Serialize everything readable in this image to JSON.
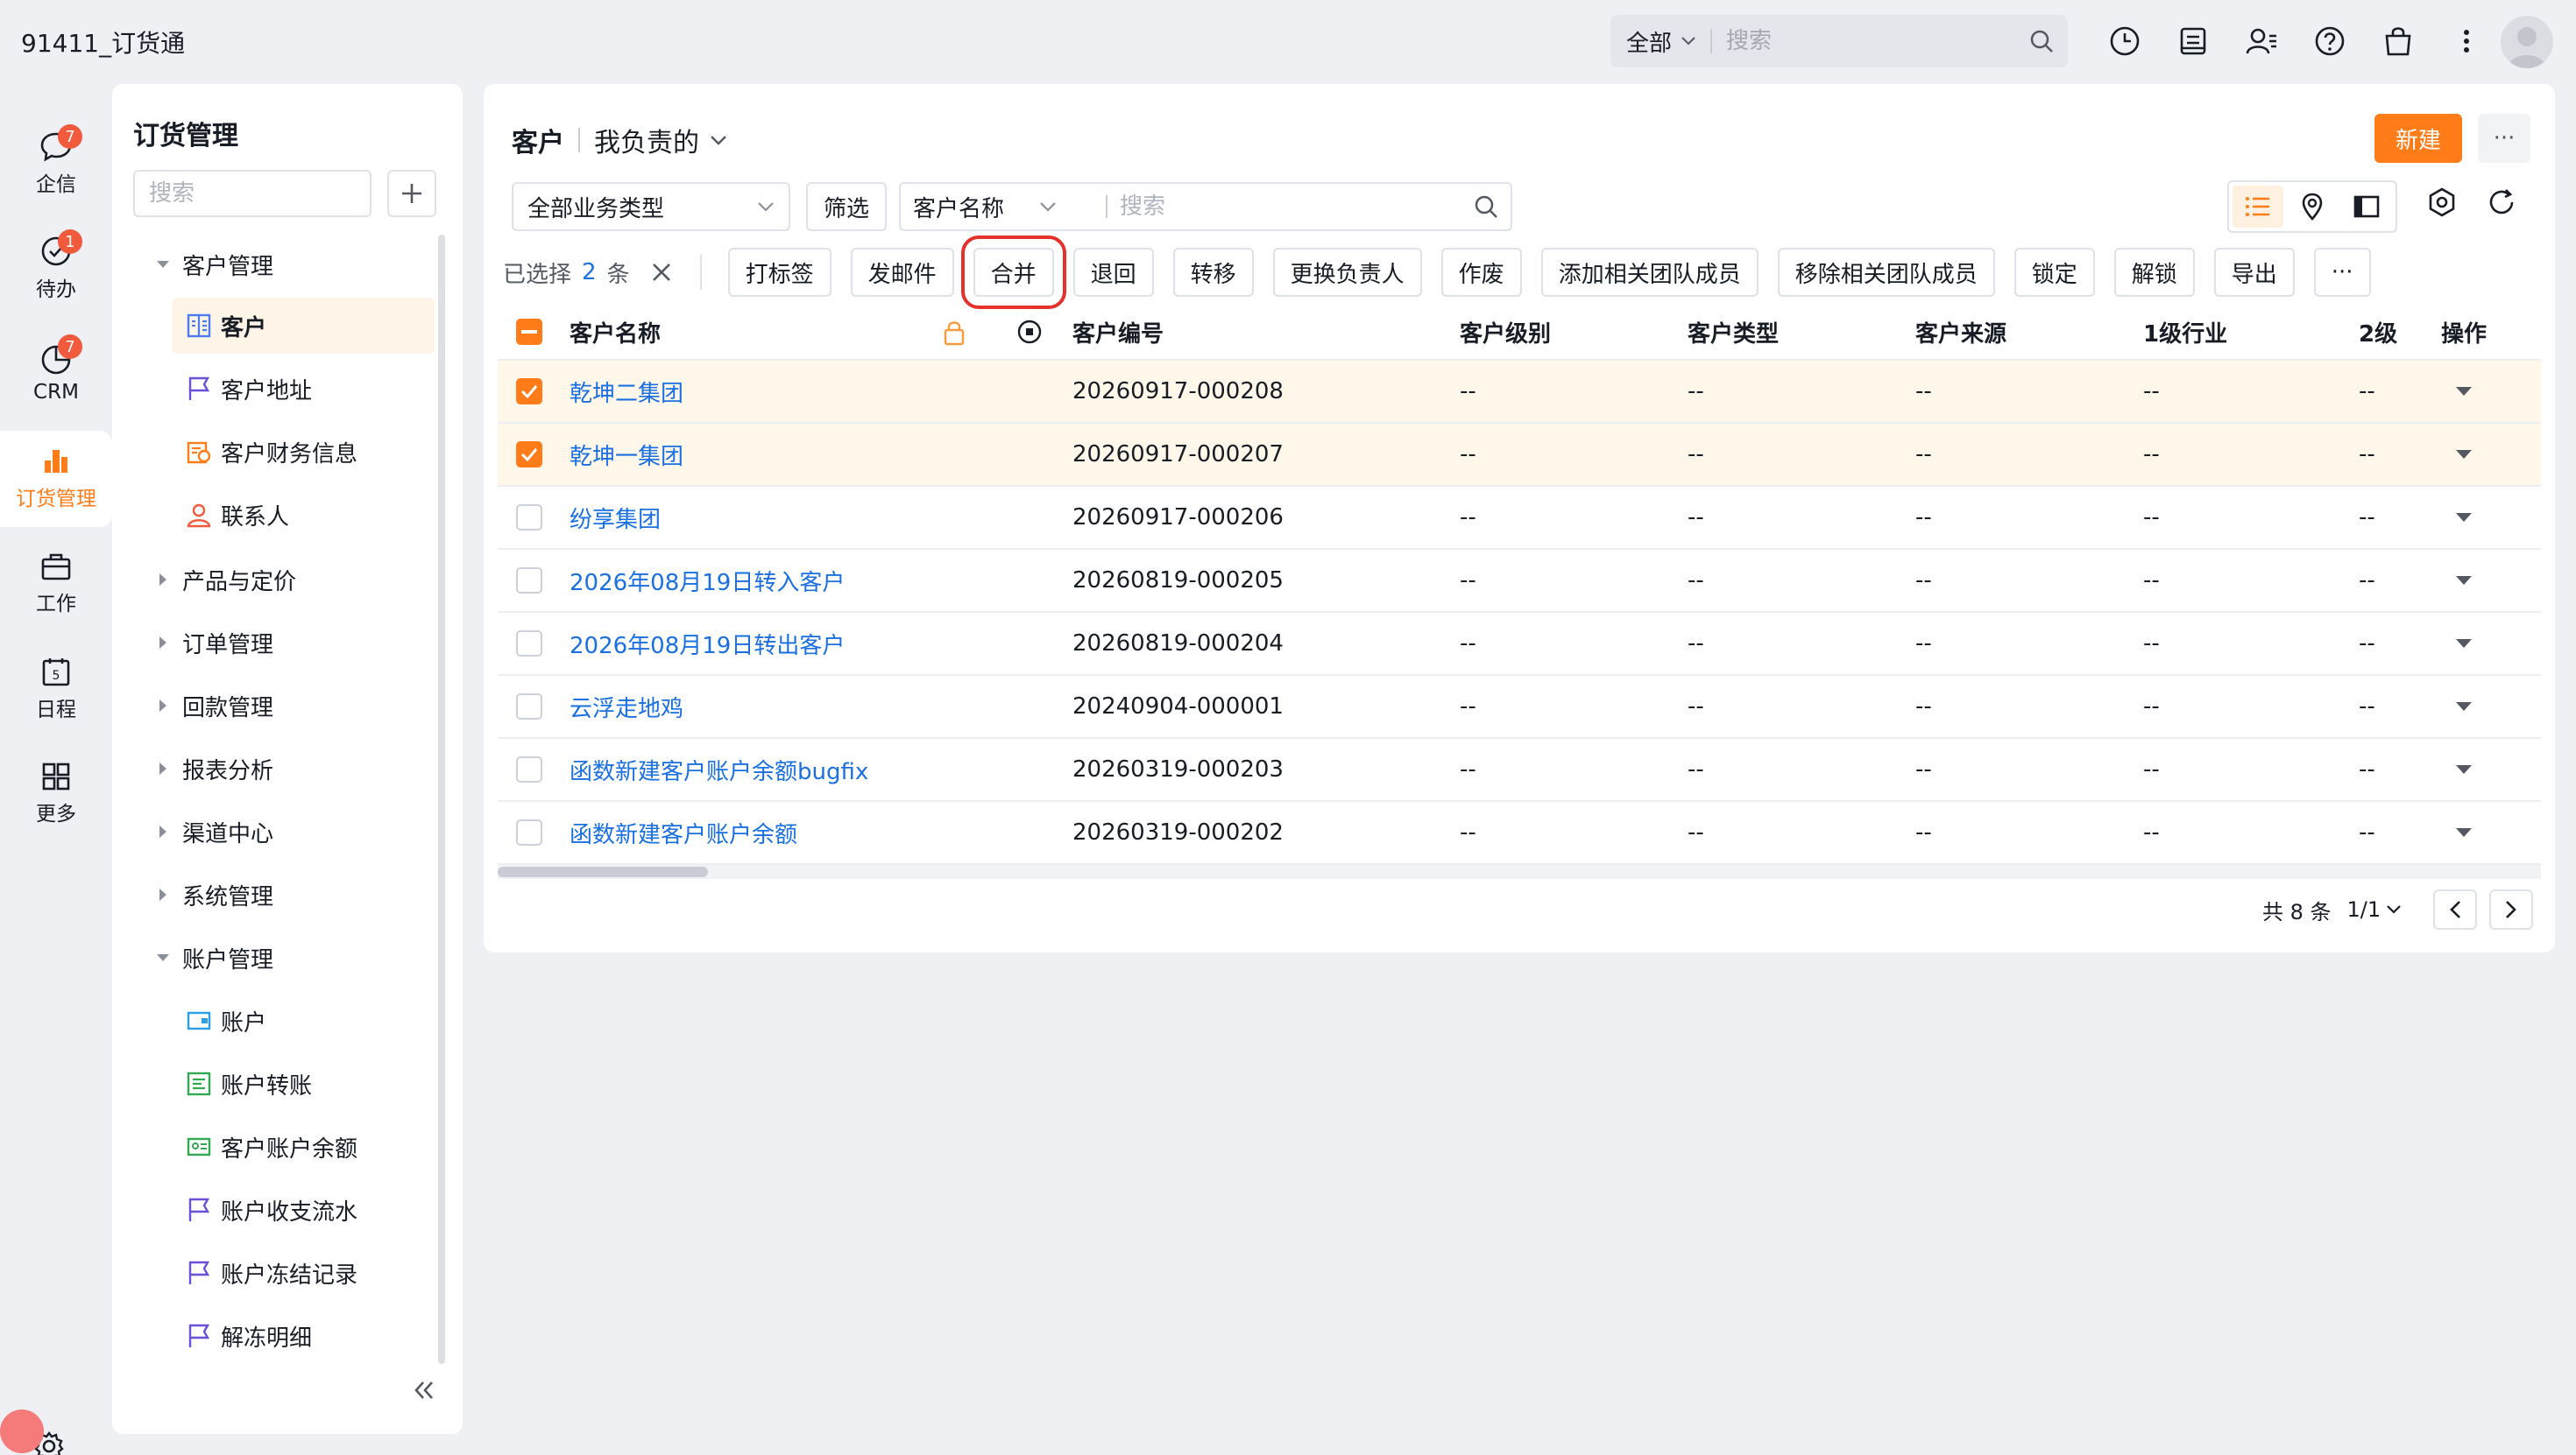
{
  "app": {
    "title": "91411_订货通"
  },
  "header": {
    "search_scope": "全部",
    "search_placeholder": "搜索",
    "icons": [
      "clock-icon",
      "report-icon",
      "contacts-icon",
      "help-icon",
      "store-icon",
      "more-vertical-icon"
    ]
  },
  "rail": {
    "items": [
      {
        "label": "企信",
        "badge": "7",
        "icon": "chat-icon"
      },
      {
        "label": "待办",
        "badge": "1",
        "icon": "todo-check-icon"
      },
      {
        "label": "CRM",
        "badge": "7",
        "icon": "crm-pie-icon"
      },
      {
        "label": "订货管理",
        "badge": "",
        "icon": "order-bars-icon"
      },
      {
        "label": "工作",
        "badge": "",
        "icon": "briefcase-icon"
      },
      {
        "label": "日程",
        "badge": "",
        "icon": "calendar-icon"
      },
      {
        "label": "更多",
        "badge": "",
        "icon": "grid-icon"
      }
    ]
  },
  "sidebar": {
    "title": "订货管理",
    "search_placeholder": "搜索",
    "tree": [
      {
        "label": "客户管理",
        "type": "group",
        "expanded": true
      },
      {
        "label": "客户",
        "type": "child",
        "icon": "customer-doc-icon",
        "active": true
      },
      {
        "label": "客户地址",
        "type": "child",
        "icon": "flag-icon"
      },
      {
        "label": "客户财务信息",
        "type": "child",
        "icon": "finance-icon"
      },
      {
        "label": "联系人",
        "type": "child",
        "icon": "contact-person-icon"
      },
      {
        "label": "产品与定价",
        "type": "group",
        "expanded": false
      },
      {
        "label": "订单管理",
        "type": "group",
        "expanded": false
      },
      {
        "label": "回款管理",
        "type": "group",
        "expanded": false
      },
      {
        "label": "报表分析",
        "type": "group",
        "expanded": false
      },
      {
        "label": "渠道中心",
        "type": "group",
        "expanded": false
      },
      {
        "label": "系统管理",
        "type": "group",
        "expanded": false
      },
      {
        "label": "账户管理",
        "type": "group",
        "expanded": true
      },
      {
        "label": "账户",
        "type": "child",
        "icon": "account-card-icon"
      },
      {
        "label": "账户转账",
        "type": "child",
        "icon": "transfer-icon"
      },
      {
        "label": "客户账户余额",
        "type": "child",
        "icon": "balance-icon"
      },
      {
        "label": "账户收支流水",
        "type": "child",
        "icon": "flag-icon"
      },
      {
        "label": "账户冻结记录",
        "type": "child",
        "icon": "flag-icon"
      },
      {
        "label": "解冻明细",
        "type": "child",
        "icon": "flag-icon"
      }
    ]
  },
  "main": {
    "title": "客户",
    "scope": "我负责的",
    "new_label": "新建",
    "more_label": "···",
    "filter": {
      "biz_type": "全部业务类型",
      "filter_label": "筛选",
      "search_field": "客户名称",
      "search_placeholder": "搜索"
    },
    "selection": {
      "prefix": "已选择",
      "count": "2",
      "suffix": "条"
    },
    "actions": [
      "打标签",
      "发邮件",
      "合并",
      "退回",
      "转移",
      "更换负责人",
      "作废",
      "添加相关团队成员",
      "移除相关团队成员",
      "锁定",
      "解锁",
      "导出"
    ],
    "actions_more": "···",
    "highlighted_action": "合并",
    "columns": [
      "客户名称",
      "客户编号",
      "客户级别",
      "客户类型",
      "客户来源",
      "1级行业",
      "2级",
      "操作"
    ],
    "rows": [
      {
        "name": "乾坤二集团",
        "no": "20260917-000208",
        "level": "--",
        "type": "--",
        "source": "--",
        "ind1": "--",
        "ind2": "--",
        "checked": true
      },
      {
        "name": "乾坤一集团",
        "no": "20260917-000207",
        "level": "--",
        "type": "--",
        "source": "--",
        "ind1": "--",
        "ind2": "--",
        "checked": true
      },
      {
        "name": "纷享集团",
        "no": "20260917-000206",
        "level": "--",
        "type": "--",
        "source": "--",
        "ind1": "--",
        "ind2": "--",
        "checked": false
      },
      {
        "name": "2026年08月19日转入客户",
        "no": "20260819-000205",
        "level": "--",
        "type": "--",
        "source": "--",
        "ind1": "--",
        "ind2": "--",
        "checked": false
      },
      {
        "name": "2026年08月19日转出客户",
        "no": "20260819-000204",
        "level": "--",
        "type": "--",
        "source": "--",
        "ind1": "--",
        "ind2": "--",
        "checked": false
      },
      {
        "name": "云浮走地鸡",
        "no": "20240904-000001",
        "level": "--",
        "type": "--",
        "source": "--",
        "ind1": "--",
        "ind2": "--",
        "checked": false
      },
      {
        "name": "函数新建客户账户余额bugfix",
        "no": "20260319-000203",
        "level": "--",
        "type": "--",
        "source": "--",
        "ind1": "--",
        "ind2": "--",
        "checked": false
      },
      {
        "name": "函数新建客户账户余额",
        "no": "20260319-000202",
        "level": "--",
        "type": "--",
        "source": "--",
        "ind1": "--",
        "ind2": "--",
        "checked": false
      }
    ],
    "pager": {
      "total": "共 8 条",
      "page": "1/1"
    }
  },
  "colors": {
    "accent": "#ff7c19",
    "link": "#1a70e0",
    "highlight": "#e5312b",
    "badge": "#f15a3d"
  }
}
